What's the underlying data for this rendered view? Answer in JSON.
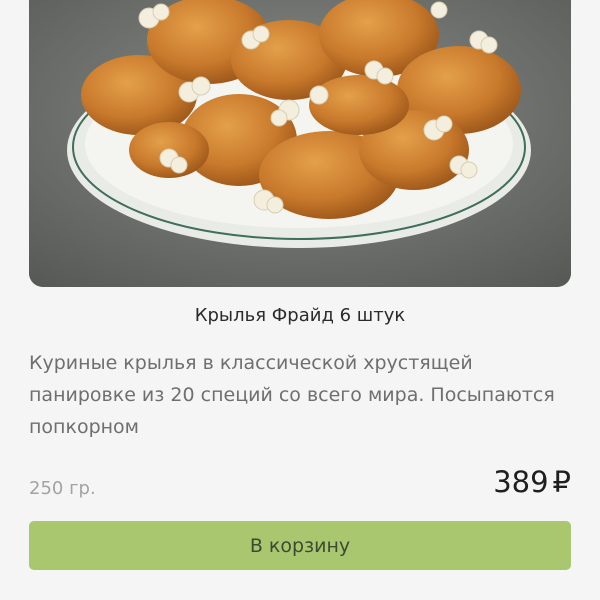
{
  "product": {
    "image_alt": "fried-chicken-wings-with-popcorn",
    "title": "Крылья Фрайд 6 штук",
    "description": "Куриные крылья в классической хрустящей панировке из 20 специй со всего мира. Посыпаются попкорном",
    "weight": "250 гр.",
    "price": "389",
    "currency": "₽",
    "add_to_cart_label": "В корзину"
  },
  "colors": {
    "button_bg": "#a8c76e",
    "page_bg": "#f5f5f5",
    "description_text": "#6f6f6f",
    "weight_text": "#a3a3a3"
  }
}
